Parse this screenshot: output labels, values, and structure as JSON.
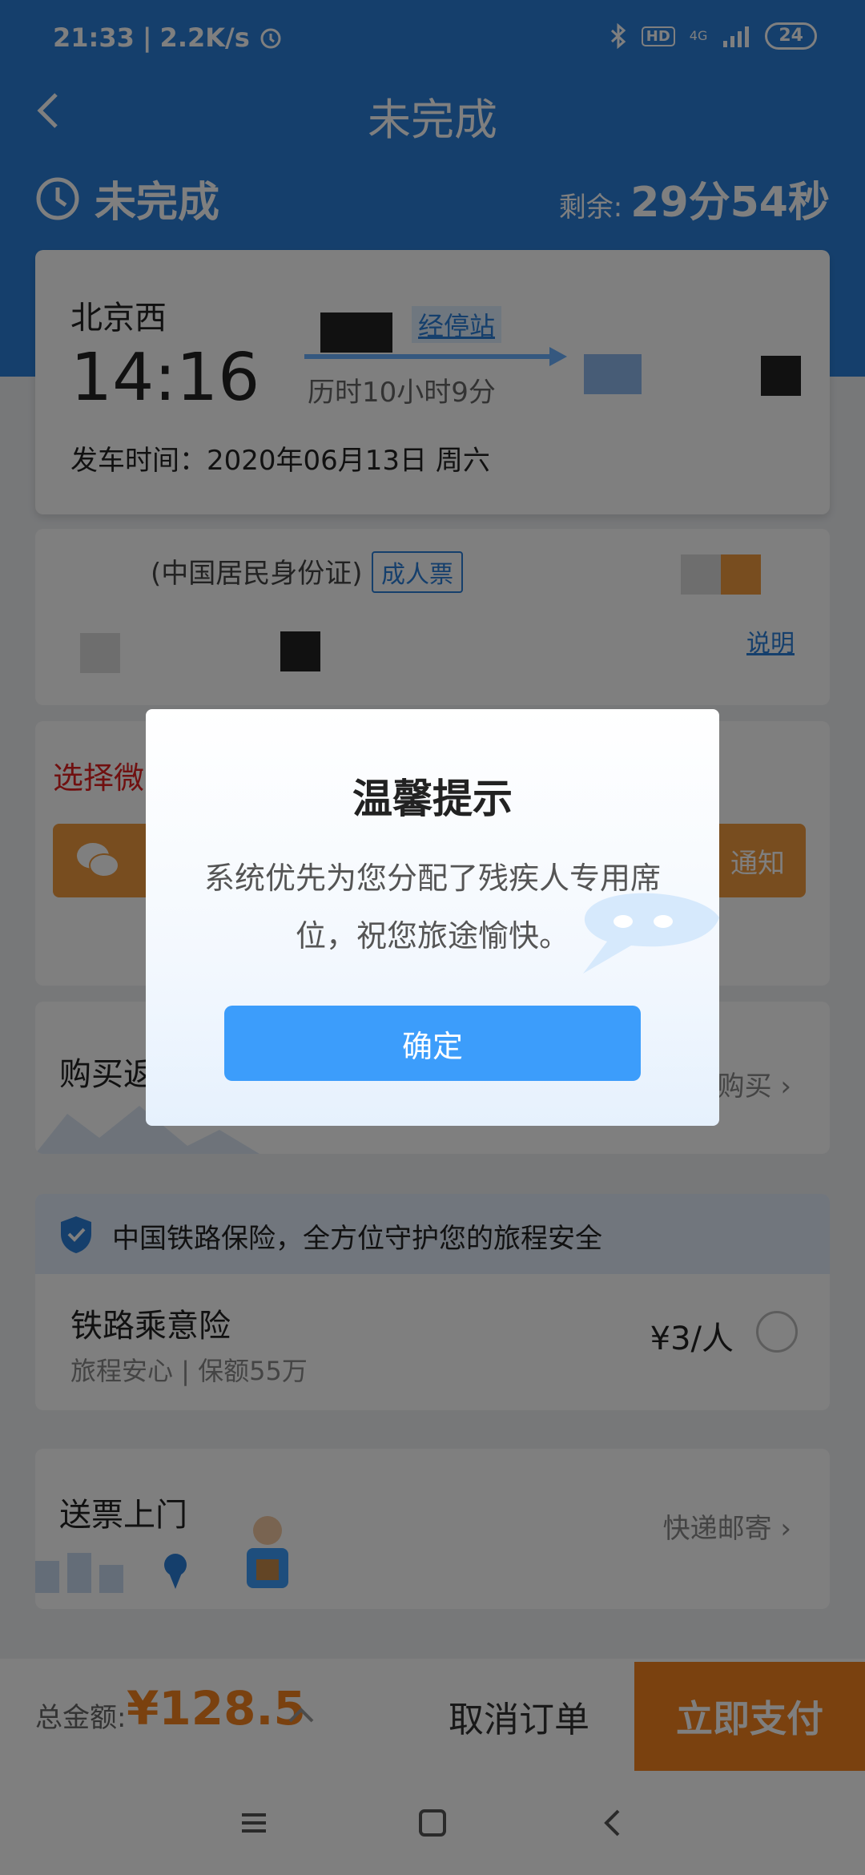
{
  "status_bar": {
    "time": "21:33",
    "network_speed": "2.2K/s",
    "hd": "HD",
    "signal": "4G",
    "battery": "24"
  },
  "header": {
    "title": "未完成",
    "state": "未完成",
    "remaining_label": "剩余:",
    "remaining_value": "29分54秒"
  },
  "trip": {
    "from_station": "北京西",
    "departure_time": "14:16",
    "stops_link": "经停站",
    "duration": "历时10小时9分",
    "departure_date": "发车时间：2020年06月13日 周六"
  },
  "passenger": {
    "id_type": "(中国居民身份证)",
    "ticket_type": "成人票",
    "explain_link": "说明"
  },
  "wechat": {
    "title": "选择微",
    "bar_label": "通知"
  },
  "return_trip": {
    "title": "购买返",
    "action": "购买"
  },
  "insurance": {
    "banner": "中国铁路保险，全方位守护您的旅程安全",
    "name": "铁路乘意险",
    "desc": "旅程安心 | 保额55万",
    "price": "¥3/人"
  },
  "delivery": {
    "title": "送票上门",
    "action": "快递邮寄"
  },
  "bottom_bar": {
    "total_label": "总金额:",
    "total_value": "¥128.5",
    "cancel_label": "取消订单",
    "pay_label": "立即支付"
  },
  "dialog": {
    "title": "温馨提示",
    "message": "系统优先为您分配了残疾人专用席位，祝您旅途愉快。",
    "confirm_label": "确定"
  },
  "colors": {
    "header_blue": "#2b7fd9",
    "accent_orange": "#f5821f",
    "dialog_button": "#3c9dfb"
  }
}
